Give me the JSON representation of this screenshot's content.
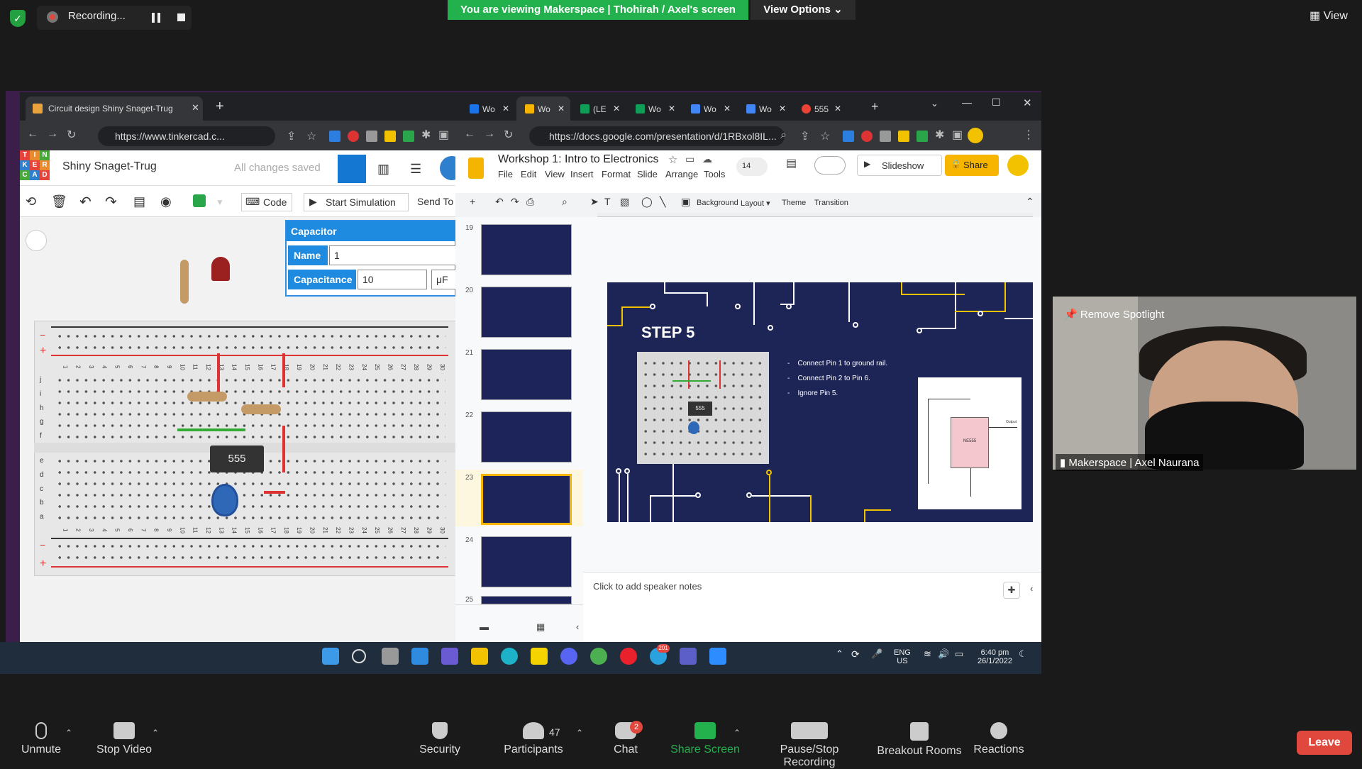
{
  "zoom": {
    "recording_label": "Recording...",
    "viewing_banner": "You are viewing Makerspace | Thohirah / Axel's screen",
    "view_options": "View Options ⌄",
    "view_label": "View",
    "spotlight_label": "Remove Spotlight",
    "participant_name": "Makerspace | Axel Naurana",
    "toolbar": {
      "unmute": "Unmute",
      "stop_video": "Stop Video",
      "security": "Security",
      "participants": "Participants",
      "participants_count": "47",
      "chat": "Chat",
      "chat_badge": "2",
      "share_screen": "Share Screen",
      "pause_stop_recording": "Pause/Stop Recording",
      "breakout_rooms": "Breakout Rooms",
      "reactions": "Reactions",
      "leave": "Leave"
    }
  },
  "tinkercad": {
    "tab_title": "Circuit design Shiny Snaget-Trug",
    "url": "https://www.tinkercad.c...",
    "logo_letters": [
      "T",
      "I",
      "N",
      "K",
      "E",
      "R",
      "C",
      "A",
      "D"
    ],
    "design_name": "Shiny Snaget-Trug",
    "save_status": "All changes saved",
    "code_label": "Code",
    "start_sim_label": "Start Simulation",
    "send_label": "Send To",
    "inspector": {
      "header": "Capacitor",
      "name_label": "Name",
      "name_value": "1",
      "capacitance_label": "Capacitance",
      "capacitance_value": "10",
      "unit": "μF"
    },
    "chip_label": "555",
    "rail_minus": "−",
    "rail_plus": "+",
    "col_numbers": [
      "1",
      "2",
      "3",
      "4",
      "5",
      "6",
      "7",
      "8",
      "9",
      "10",
      "11",
      "12",
      "13",
      "14",
      "15",
      "16",
      "17",
      "18",
      "19",
      "20",
      "21",
      "22",
      "23",
      "24",
      "25",
      "26",
      "27",
      "28",
      "29",
      "30"
    ],
    "rows_top": [
      "j",
      "i",
      "h",
      "g",
      "f"
    ],
    "rows_bottom": [
      "e",
      "d",
      "c",
      "b",
      "a"
    ]
  },
  "slides": {
    "tabs": [
      "Wo",
      "Wo",
      "(LE",
      "Wo",
      "Wo",
      "Wo",
      "555"
    ],
    "url": "https://docs.google.com/presentation/d/1RBxol8IL...",
    "doc_title": "Workshop 1: Intro to Electronics",
    "menu": [
      "File",
      "Edit",
      "View",
      "Insert",
      "Format",
      "Slide",
      "Arrange",
      "Tools"
    ],
    "users_count": "14",
    "slideshow_label": "Slideshow",
    "share_label": "Share",
    "toolbar_labels": [
      "Background",
      "Layout ▾",
      "Theme",
      "Transition"
    ],
    "slide_numbers": [
      "19",
      "20",
      "21",
      "22",
      "23",
      "24",
      "25"
    ],
    "active_slide": "23",
    "slide": {
      "title": "STEP 5",
      "bullets": [
        "Connect Pin 1 to ground rail.",
        "Connect Pin 2 to Pin 6.",
        "Ignore Pin 5."
      ],
      "chip_label": "555",
      "schematic_chip": "NE555",
      "schematic_output": "Output"
    },
    "speaker_notes": "Click to add speaker notes"
  },
  "taskbar": {
    "lang": "ENG",
    "region": "US",
    "time": "6:40 pm",
    "date": "26/1/2022",
    "telegram_badge": "201"
  },
  "colors": {
    "zoom_green": "#23b14d",
    "leave_red": "#e0483e",
    "tinkercad_blue": "#1f8be0",
    "slide_navy": "#1d2557",
    "slides_share_yellow": "#f7b500"
  }
}
